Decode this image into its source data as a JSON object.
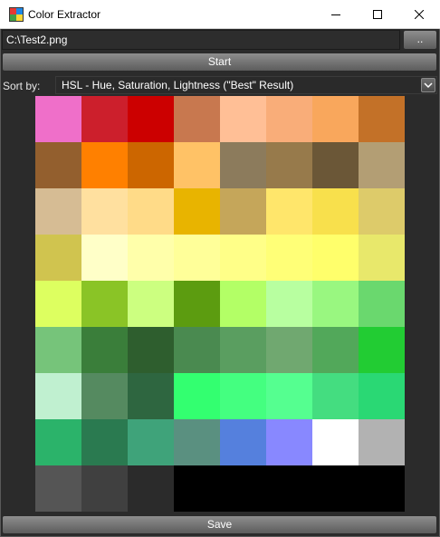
{
  "window": {
    "title": "Color Extractor"
  },
  "toolbar": {
    "path_value": "C:\\Test2.png",
    "browse_label": "..",
    "start_label": "Start"
  },
  "sort": {
    "label": "Sort by:",
    "selected": "HSL - Hue, Saturation, Lightness (\"Best\" Result)"
  },
  "swatches": [
    "#ef6fc9",
    "#cc1f2c",
    "#cc0000",
    "#c8784f",
    "#ffbf96",
    "#f9ad79",
    "#f9a75c",
    "#c37128",
    "#935f2e",
    "#ff8000",
    "#cc6600",
    "#ffc266",
    "#8c7b5c",
    "#977a4b",
    "#6b5737",
    "#b39e74",
    "#d6bc94",
    "#ffe09f",
    "#ffdb88",
    "#e8b400",
    "#c5a65a",
    "#ffe66b",
    "#f8e04c",
    "#ddcb6a",
    "#d0c44f",
    "#ffffc8",
    "#ffffaa",
    "#ffff99",
    "#ffff88",
    "#ffff77",
    "#ffff6b",
    "#e8e86b",
    "#ddff60",
    "#8ac426",
    "#ccff80",
    "#5c9c10",
    "#b3ff66",
    "#b8ffa0",
    "#99f780",
    "#6ad86e",
    "#76c47a",
    "#3a7e3a",
    "#2e5e2e",
    "#4a8a50",
    "#5a9e60",
    "#70a870",
    "#52a85a",
    "#22cc33",
    "#c0f0d0",
    "#558a60",
    "#2e6640",
    "#33ff70",
    "#44ff80",
    "#55ff90",
    "#44dd80",
    "#2ad874",
    "#2bb36a",
    "#2a7a50",
    "#3fa37a",
    "#5a9080",
    "#5580dd",
    "#8888ff",
    "#ffffff",
    "#b2b2b2",
    "#555555",
    "#404040",
    "#2b2b2b",
    "#000000",
    "#000000",
    "#000000",
    "#000000",
    "#000000"
  ],
  "footer": {
    "save_label": "Save"
  },
  "colors": {
    "window_bg": "#2b2b2b",
    "button_top": "#8e8e8e",
    "button_bottom": "#5c5c5c"
  },
  "icons": [
    "app-palette-icon",
    "minimize-icon",
    "maximize-icon",
    "close-icon",
    "chevron-down-icon"
  ]
}
